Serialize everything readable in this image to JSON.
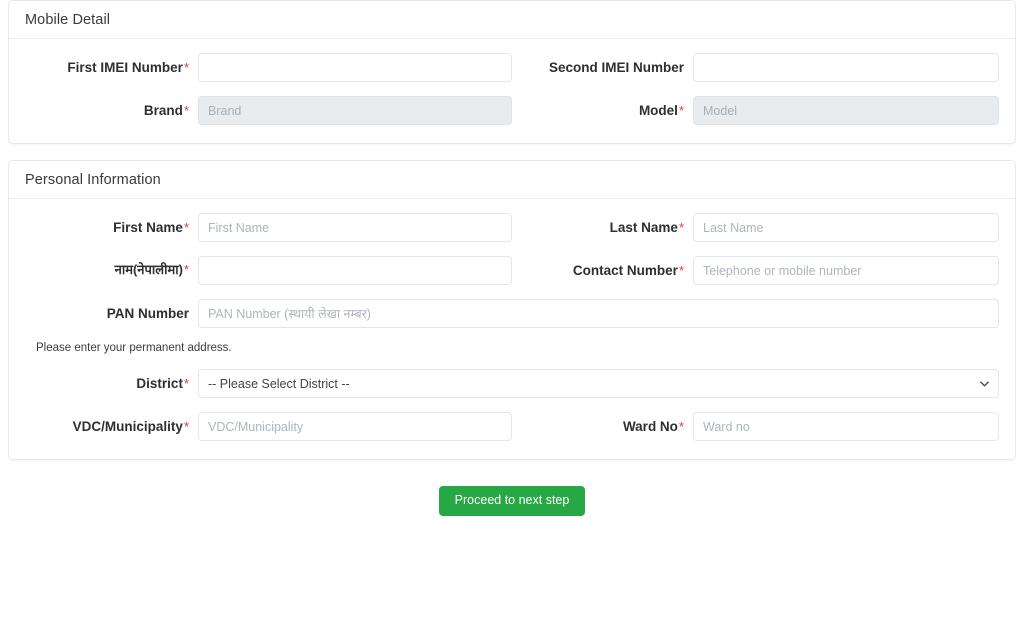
{
  "colors": {
    "required_asterisk": "#e8372c",
    "primary_button_bg": "#28a745",
    "disabled_field_bg": "#e9ecef",
    "card_border": "#e6e8ea",
    "placeholder_text": "#adb5bd"
  },
  "panels": [
    {
      "title": "Mobile Detail",
      "rows": [
        {
          "left": {
            "label": "First IMEI Number",
            "required": true,
            "type": "text",
            "value": "",
            "placeholder": "",
            "disabled": false
          },
          "right": {
            "label": "Second IMEI Number",
            "required": false,
            "type": "text",
            "value": "",
            "placeholder": "",
            "disabled": false
          }
        },
        {
          "left": {
            "label": "Brand",
            "required": true,
            "type": "text",
            "value": "",
            "placeholder": "Brand",
            "disabled": true
          },
          "right": {
            "label": "Model",
            "required": true,
            "type": "text",
            "value": "",
            "placeholder": "Model",
            "disabled": true
          }
        }
      ]
    },
    {
      "title": "Personal Information",
      "rows": [
        {
          "left": {
            "label": "First Name",
            "required": true,
            "type": "text",
            "value": "",
            "placeholder": "First Name",
            "disabled": false
          },
          "right": {
            "label": "Last Name",
            "required": true,
            "type": "text",
            "value": "",
            "placeholder": "Last Name",
            "disabled": false
          }
        },
        {
          "left": {
            "label": "नाम(नेपालीमा)",
            "required": true,
            "type": "text",
            "value": "",
            "placeholder": "",
            "disabled": false
          },
          "right": {
            "label": "Contact Number",
            "required": true,
            "type": "text",
            "value": "",
            "placeholder": "Telephone or mobile number",
            "disabled": false
          }
        }
      ],
      "pan": {
        "label": "PAN Number",
        "required": false,
        "type": "text",
        "value": "",
        "placeholder": "PAN Number (स्थायी लेखा नम्बर)",
        "disabled": false
      },
      "address_note": "Please enter your permanent address.",
      "district": {
        "label": "District",
        "required": true,
        "type": "select",
        "selected": "-- Please Select District --",
        "options": [
          "-- Please Select District --"
        ]
      },
      "address_rows": [
        {
          "left": {
            "label": "VDC/Municipality",
            "required": true,
            "type": "text",
            "value": "",
            "placeholder": "VDC/Municipality",
            "disabled": false
          },
          "right": {
            "label": "Ward No",
            "required": true,
            "type": "text",
            "value": "",
            "placeholder": "Ward no",
            "disabled": false
          }
        }
      ]
    }
  ],
  "footer": {
    "submit_label": "Proceed to next step"
  }
}
